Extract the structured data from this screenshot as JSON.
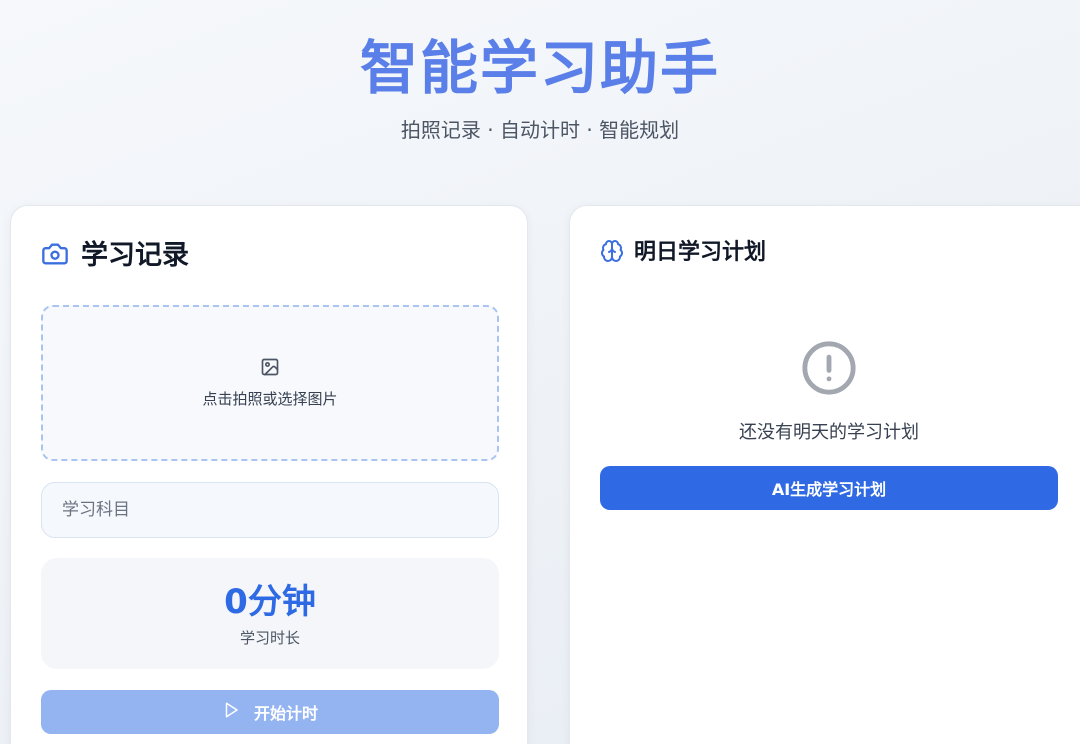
{
  "header": {
    "title": "智能学习助手",
    "subtitle": "拍照记录 · 自动计时 · 智能规划"
  },
  "record_card": {
    "title": "学习记录",
    "icon": "camera-icon",
    "upload": {
      "icon": "image-icon",
      "text": "点击拍照或选择图片"
    },
    "subject_input": {
      "placeholder": "学习科目",
      "value": ""
    },
    "timer": {
      "value": "0分钟",
      "label": "学习时长"
    },
    "start_button": {
      "icon": "play-icon",
      "label": "开始计时"
    }
  },
  "plan_card": {
    "title": "明日学习计划",
    "icon": "brain-icon",
    "empty_icon": "alert-circle-icon",
    "empty_text": "还没有明天的学习计划",
    "generate_button": "AI生成学习计划"
  },
  "colors": {
    "accent": "#2f6ae4",
    "title": "#5b7fe8",
    "disabled_button": "#93b3f1"
  }
}
